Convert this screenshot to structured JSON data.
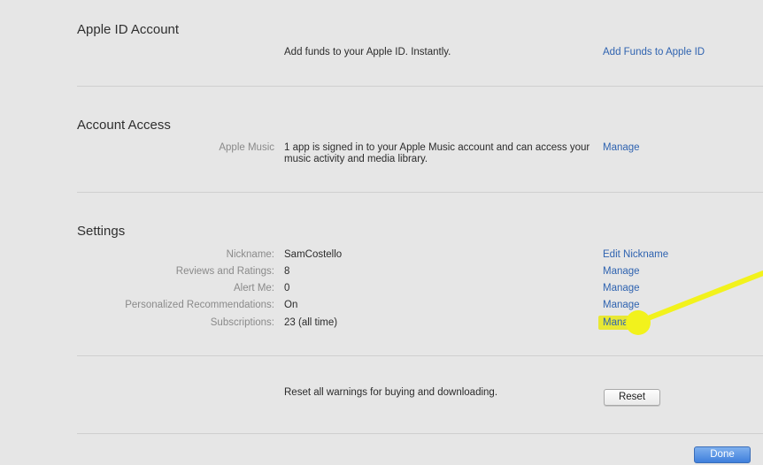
{
  "apple_id_account": {
    "title": "Apple ID Account",
    "description": "Add funds to your Apple ID. Instantly.",
    "link": "Add Funds to Apple ID"
  },
  "account_access": {
    "title": "Account Access",
    "label": "Apple Music",
    "description_line1": "1 app is signed in to your Apple Music account and can access your",
    "description_line2": "music activity and media library.",
    "link": "Manage"
  },
  "settings": {
    "title": "Settings",
    "rows": [
      {
        "label": "Nickname:",
        "value": "SamCostello",
        "link": "Edit Nickname"
      },
      {
        "label": "Reviews and Ratings:",
        "value": "8",
        "link": "Manage"
      },
      {
        "label": "Alert Me:",
        "value": "0",
        "link": "Manage"
      },
      {
        "label": "Personalized Recommendations:",
        "value": "On",
        "link": "Manage"
      },
      {
        "label": "Subscriptions:",
        "value": "23 (all time)",
        "link": "Mana"
      }
    ]
  },
  "warnings": {
    "description": "Reset all warnings for buying and downloading.",
    "reset_label": "Reset"
  },
  "footer": {
    "done_label": "Done"
  },
  "annotation": {
    "highlight_color": "#e8e82a"
  }
}
